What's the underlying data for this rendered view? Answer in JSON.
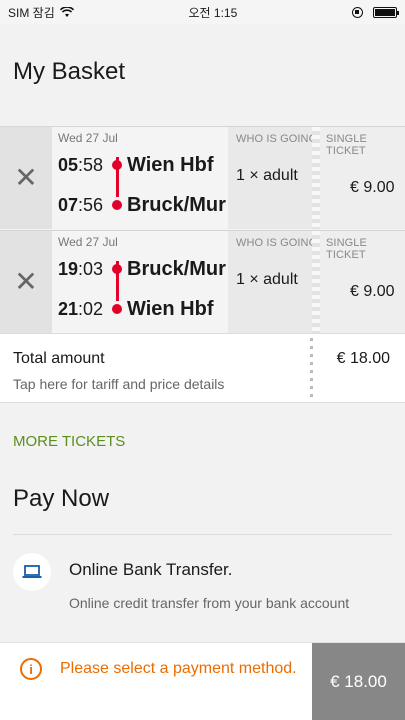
{
  "status_bar": {
    "carrier": "SIM 잠김",
    "time": "오전 1:15",
    "battery_level": 1.0
  },
  "page": {
    "title": "My Basket"
  },
  "tickets": [
    {
      "date": "Wed 27 Jul",
      "dep_hour": "05",
      "dep_min": ":58",
      "dep_station": "Wien Hbf",
      "arr_hour": "07",
      "arr_min": ":56",
      "arr_station": "Bruck/Mur",
      "who_header": "WHO IS GOING",
      "who": "1 × adult",
      "ticket_header": "SINGLE TICKET",
      "price": "€ 9.00"
    },
    {
      "date": "Wed 27 Jul",
      "dep_hour": "19",
      "dep_min": ":03",
      "dep_station": "Bruck/Mur",
      "arr_hour": "21",
      "arr_min": ":02",
      "arr_station": "Wien Hbf",
      "who_header": "WHO IS GOING",
      "who": "1 × adult",
      "ticket_header": "SINGLE TICKET",
      "price": "€ 9.00"
    }
  ],
  "total": {
    "label": "Total amount",
    "sub": "Tap here for tariff and price details",
    "amount": "€ 18.00"
  },
  "more_tickets": "MORE TICKETS",
  "pay_now": "Pay Now",
  "payment_method": {
    "title": "Online Bank Transfer.",
    "description": "Online credit transfer from your bank account",
    "icon": "laptop-icon"
  },
  "footer": {
    "warning": "Please select a payment method.",
    "pay_button": "€ 18.00"
  },
  "colors": {
    "accent_red": "#e2002a",
    "link_green": "#5a8f1e",
    "warning_orange": "#ec6c00",
    "pay_button_bg": "#878787"
  }
}
